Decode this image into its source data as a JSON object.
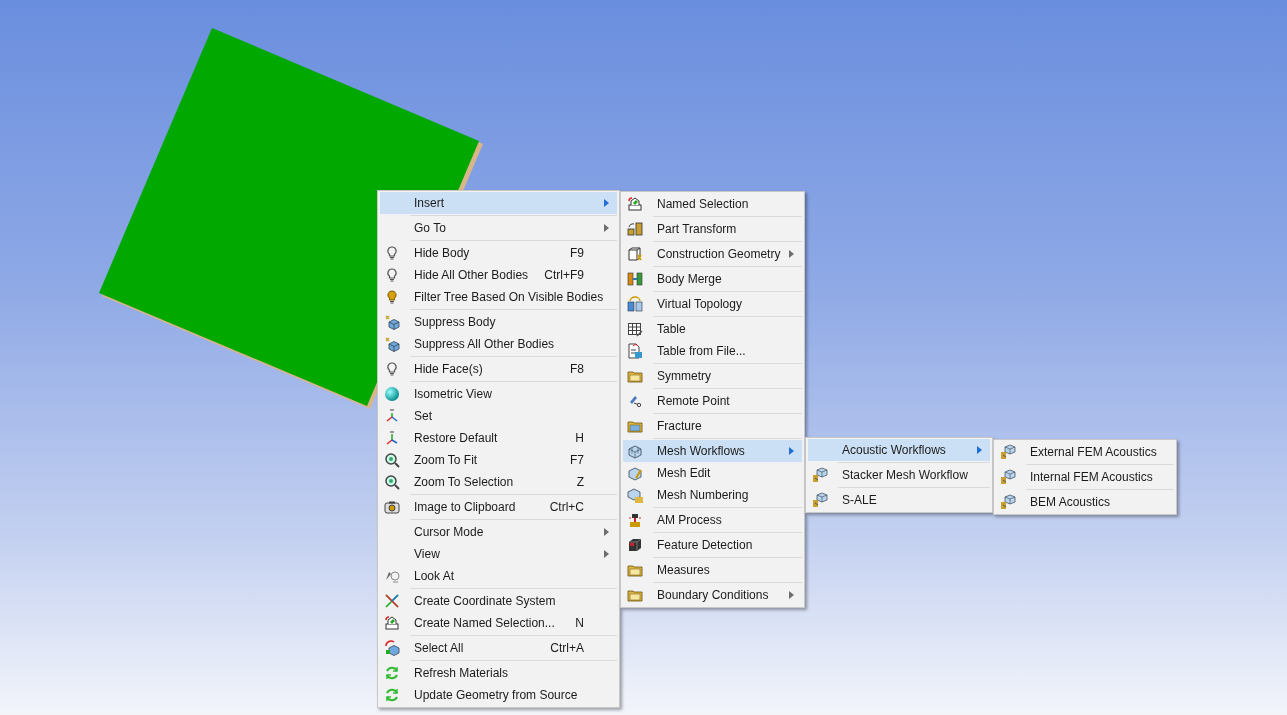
{
  "menus": [
    {
      "groups": [
        [
          {
            "label": "Insert",
            "submenu": true,
            "selected": true
          }
        ],
        [
          {
            "label": "Go To",
            "submenu": true,
            "selected": false
          }
        ],
        [
          {
            "label": "Hide Body",
            "shortcut": "F9",
            "submenu": false,
            "selected": false
          },
          {
            "label": "Hide All Other Bodies",
            "shortcut": "Ctrl+F9",
            "submenu": false,
            "selected": false
          },
          {
            "label": "Filter Tree Based On Visible Bodies",
            "submenu": false,
            "selected": false
          }
        ],
        [
          {
            "label": "Suppress Body",
            "submenu": false,
            "selected": false
          },
          {
            "label": "Suppress All Other Bodies",
            "submenu": false,
            "selected": false
          }
        ],
        [
          {
            "label": "Hide Face(s)",
            "shortcut": "F8",
            "submenu": false,
            "selected": false
          }
        ],
        [
          {
            "label": "Isometric View",
            "submenu": false,
            "selected": false
          },
          {
            "label": "Set",
            "submenu": false,
            "selected": false
          },
          {
            "label": "Restore Default",
            "shortcut": "H",
            "submenu": false,
            "selected": false
          },
          {
            "label": "Zoom To Fit",
            "shortcut": "F7",
            "submenu": false,
            "selected": false
          },
          {
            "label": "Zoom To Selection",
            "shortcut": "Z",
            "submenu": false,
            "selected": false
          }
        ],
        [
          {
            "label": "Image to Clipboard",
            "shortcut": "Ctrl+C",
            "submenu": false,
            "selected": false
          }
        ],
        [
          {
            "label": "Cursor Mode",
            "submenu": true,
            "selected": false
          },
          {
            "label": "View",
            "submenu": true,
            "selected": false
          },
          {
            "label": "Look At",
            "submenu": false,
            "selected": false
          }
        ],
        [
          {
            "label": "Create Coordinate System",
            "submenu": false,
            "selected": false
          },
          {
            "label": "Create Named Selection...",
            "shortcut": "N",
            "submenu": false,
            "selected": false
          }
        ],
        [
          {
            "label": "Select All",
            "shortcut": "Ctrl+A",
            "submenu": false,
            "selected": false
          }
        ],
        [
          {
            "label": "Refresh Materials",
            "submenu": false,
            "selected": false
          },
          {
            "label": "Update Geometry from Source",
            "submenu": false,
            "selected": false
          }
        ]
      ]
    },
    {
      "groups": [
        [
          {
            "label": "Named Selection",
            "submenu": false,
            "selected": false
          }
        ],
        [
          {
            "label": "Part Transform",
            "submenu": false,
            "selected": false
          }
        ],
        [
          {
            "label": "Construction Geometry",
            "submenu": true,
            "selected": false
          }
        ],
        [
          {
            "label": "Body Merge",
            "submenu": false,
            "selected": false
          }
        ],
        [
          {
            "label": "Virtual Topology",
            "submenu": false,
            "selected": false
          }
        ],
        [
          {
            "label": "Table",
            "submenu": false,
            "selected": false
          },
          {
            "label": "Table from File...",
            "submenu": false,
            "selected": false
          }
        ],
        [
          {
            "label": "Symmetry",
            "submenu": false,
            "selected": false
          }
        ],
        [
          {
            "label": "Remote Point",
            "submenu": false,
            "selected": false
          }
        ],
        [
          {
            "label": "Fracture",
            "submenu": false,
            "selected": false
          }
        ],
        [
          {
            "label": "Mesh Workflows",
            "submenu": true,
            "selected": true
          },
          {
            "label": "Mesh Edit",
            "submenu": false,
            "selected": false
          },
          {
            "label": "Mesh Numbering",
            "submenu": false,
            "selected": false
          }
        ],
        [
          {
            "label": "AM Process",
            "submenu": false,
            "selected": false
          }
        ],
        [
          {
            "label": "Feature Detection",
            "submenu": false,
            "selected": false
          }
        ],
        [
          {
            "label": "Measures",
            "submenu": false,
            "selected": false
          }
        ],
        [
          {
            "label": "Boundary Conditions",
            "submenu": true,
            "selected": false
          }
        ]
      ]
    },
    {
      "groups": [
        [
          {
            "label": "Acoustic Workflows",
            "submenu": true,
            "selected": true
          }
        ],
        [
          {
            "label": "Stacker Mesh Workflow",
            "submenu": false,
            "selected": false
          }
        ],
        [
          {
            "label": "S-ALE",
            "submenu": false,
            "selected": false
          }
        ]
      ]
    },
    {
      "groups": [
        [
          {
            "label": "External FEM Acoustics",
            "submenu": false,
            "selected": false
          }
        ],
        [
          {
            "label": "Internal FEM Acoustics",
            "submenu": false,
            "selected": false
          }
        ],
        [
          {
            "label": "BEM Acoustics",
            "submenu": false,
            "selected": false
          }
        ]
      ]
    }
  ]
}
